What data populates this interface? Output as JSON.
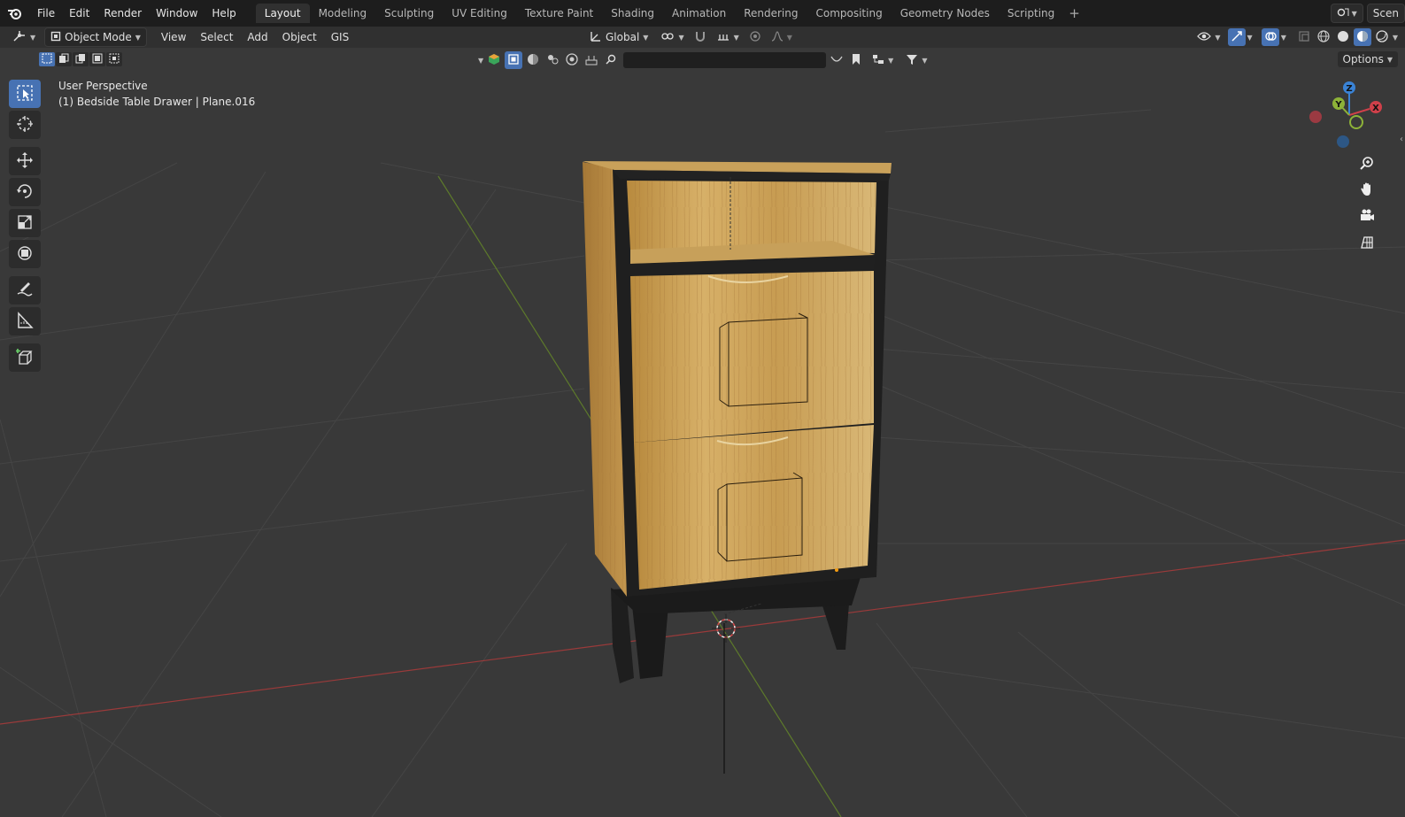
{
  "menu": [
    "File",
    "Edit",
    "Render",
    "Window",
    "Help"
  ],
  "workspaces": [
    {
      "label": "Layout",
      "active": true
    },
    {
      "label": "Modeling"
    },
    {
      "label": "Sculpting"
    },
    {
      "label": "UV Editing"
    },
    {
      "label": "Texture Paint"
    },
    {
      "label": "Shading"
    },
    {
      "label": "Animation"
    },
    {
      "label": "Rendering"
    },
    {
      "label": "Compositing"
    },
    {
      "label": "Geometry Nodes"
    },
    {
      "label": "Scripting"
    }
  ],
  "workspace_add": "+",
  "scene_label": "Scen",
  "header": {
    "mode": "Object Mode",
    "menus": [
      "View",
      "Select",
      "Add",
      "Object",
      "GIS"
    ],
    "orientation": "Global"
  },
  "viewport": {
    "options_label": "Options",
    "perspective": "User Perspective",
    "active_object": "(1) Bedside Table Drawer | Plane.016"
  },
  "gizmo": {
    "z": "Z",
    "y": "Y",
    "x": "X"
  },
  "colors": {
    "accent": "#4772b3",
    "x_axis": "#d0404a",
    "y_axis": "#8db238",
    "z_axis": "#3a83d6",
    "wood": "#c9a35a",
    "frame": "#1e1e1e"
  },
  "icons": {
    "toolbar": [
      "select-box-icon",
      "cursor-icon",
      "move-icon",
      "rotate-icon",
      "scale-icon",
      "transform-icon",
      "annotate-icon",
      "measure-icon",
      "add-cube-icon"
    ],
    "navigation": [
      "zoom-icon",
      "pan-hand-icon",
      "camera-icon",
      "grid-view-icon"
    ]
  }
}
